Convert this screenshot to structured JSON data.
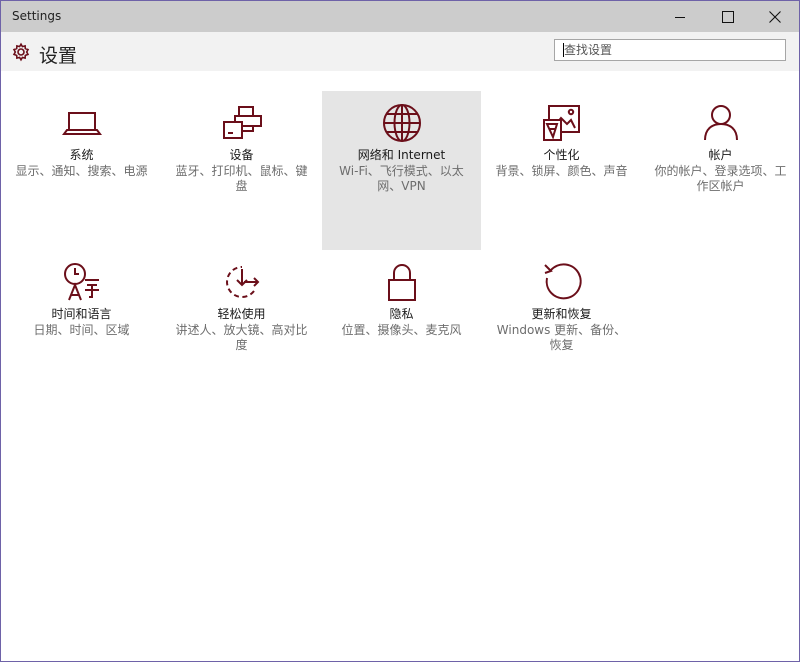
{
  "window": {
    "title": "Settings",
    "minimize_icon": "minimize-icon",
    "maximize_icon": "maximize-icon",
    "close_icon": "close-icon"
  },
  "header": {
    "icon": "gear-icon",
    "title": "设置",
    "search_placeholder": "查找设置"
  },
  "colors": {
    "accent": "#6b0f1a",
    "titlebar": "#cccccc",
    "header_bg": "#f2f2f2",
    "hover_tile": "#e5e5e5",
    "window_border": "#6e62a8"
  },
  "tiles": [
    {
      "icon": "laptop-icon",
      "title": "系统",
      "description": "显示、通知、搜索、电源"
    },
    {
      "icon": "devices-icon",
      "title": "设备",
      "description": "蓝牙、打印机、鼠标、键盘"
    },
    {
      "icon": "globe-icon",
      "title": "网络和 Internet",
      "description": "Wi-Fi、飞行模式、以太网、VPN"
    },
    {
      "icon": "personalization-icon",
      "title": "个性化",
      "description": "背景、锁屏、颜色、声音"
    },
    {
      "icon": "person-icon",
      "title": "帐户",
      "description": "你的帐户、登录选项、工作区帐户"
    },
    {
      "icon": "time-language-icon",
      "title": "时间和语言",
      "description": "日期、时间、区域"
    },
    {
      "icon": "ease-of-access-icon",
      "title": "轻松使用",
      "description": "讲述人、放大镜、高对比度"
    },
    {
      "icon": "lock-icon",
      "title": "隐私",
      "description": "位置、摄像头、麦克风"
    },
    {
      "icon": "update-icon",
      "title": "更新和恢复",
      "description": "Windows 更新、备份、恢复"
    }
  ]
}
